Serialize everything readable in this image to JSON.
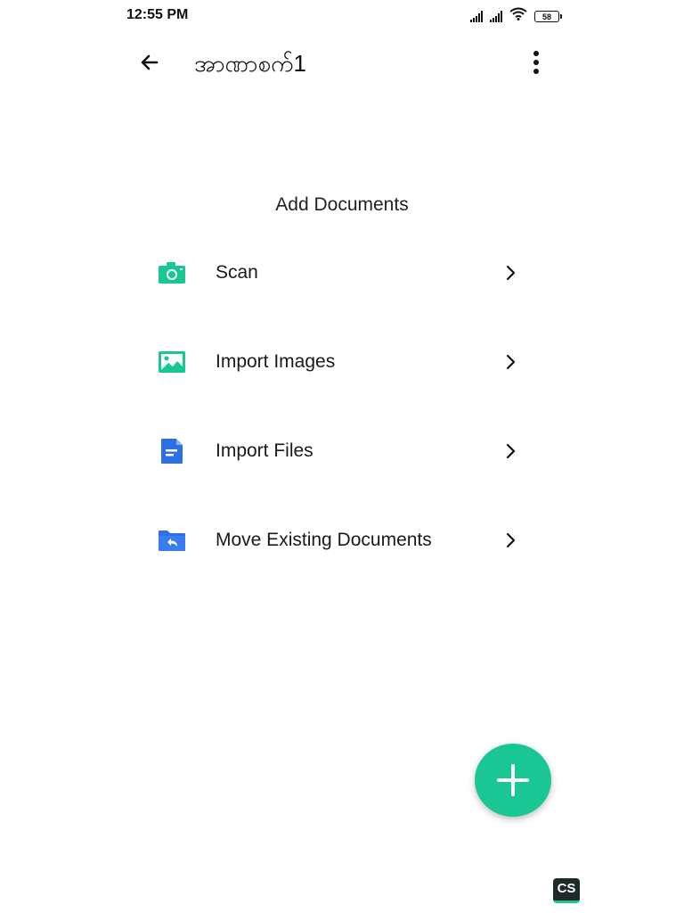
{
  "status_bar": {
    "time": "12:55 PM",
    "battery": "58",
    "icons": [
      "signal-icon",
      "signal-icon",
      "wifi-icon",
      "battery-icon"
    ]
  },
  "app_bar": {
    "title": "အာဏာစက်1",
    "back_icon": "arrow-left-icon",
    "more_icon": "more-vertical-icon"
  },
  "main": {
    "section_title": "Add Documents",
    "items": [
      {
        "label": "Scan",
        "icon": "camera-icon",
        "color": "#19c694"
      },
      {
        "label": "Import Images",
        "icon": "image-icon",
        "color": "#19c694"
      },
      {
        "label": "Import Files",
        "icon": "document-icon",
        "color": "#2f6fe4"
      },
      {
        "label": "Move Existing Documents",
        "icon": "folder-move-icon",
        "color": "#2f6fe4"
      }
    ]
  },
  "fab": {
    "icon": "plus-icon",
    "color": "#19c694"
  },
  "watermark": {
    "text": "CS"
  }
}
